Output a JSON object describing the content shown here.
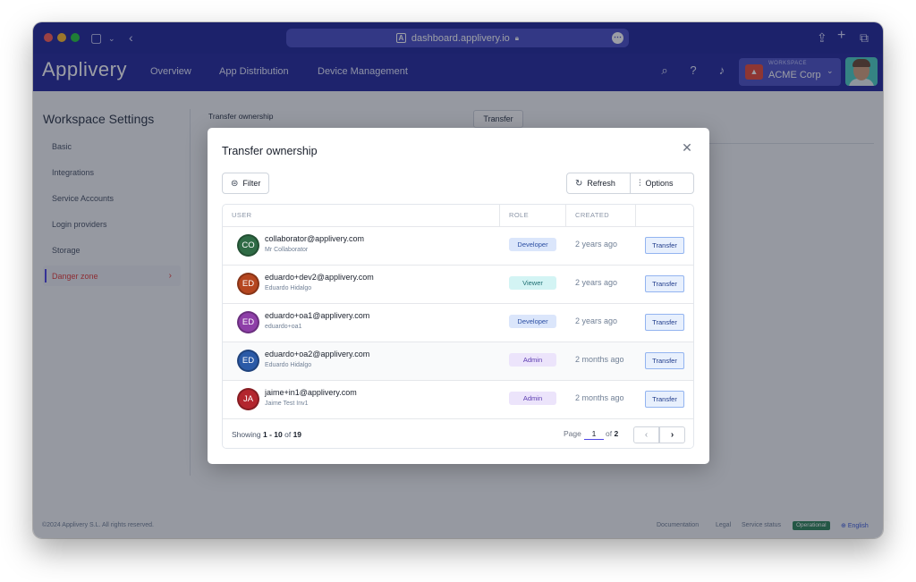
{
  "browser": {
    "url": "dashboard.applivery.io",
    "favicon_letter": "A",
    "more_glyph": "•••"
  },
  "header": {
    "logo": "Applivery",
    "nav": [
      "Overview",
      "App Distribution",
      "Device Management"
    ],
    "workspace_label": "WORKSPACE",
    "workspace_name": "ACME Corp"
  },
  "sidebar": {
    "title": "Workspace Settings",
    "items": [
      {
        "label": "Basic"
      },
      {
        "label": "Integrations"
      },
      {
        "label": "Service Accounts"
      },
      {
        "label": "Login providers"
      },
      {
        "label": "Storage"
      },
      {
        "label": "Danger zone",
        "active": true
      }
    ]
  },
  "background": {
    "section_title": "Transfer ownership",
    "button": "Transfer"
  },
  "footer": {
    "copyright": "©2024 Applivery S.L. All rights reserved.",
    "links": [
      "Documentation",
      "Legal",
      "Service status"
    ],
    "status_badge": "Operational",
    "language": "English"
  },
  "modal": {
    "title": "Transfer ownership",
    "filter_label": "Filter",
    "refresh_label": "Refresh",
    "options_label": "Options",
    "columns": [
      "USER",
      "ROLE",
      "CREATED"
    ],
    "rows": [
      {
        "initials": "CO",
        "email": "collaborator@applivery.com",
        "name": "Mr Collaborator",
        "role": "Developer",
        "created": "2 years ago",
        "action": "Transfer",
        "avatar_color": "#2f6b45"
      },
      {
        "initials": "ED",
        "email": "eduardo+dev2@applivery.com",
        "name": "Eduardo Hidalgo",
        "role": "Viewer",
        "created": "2 years ago",
        "action": "Transfer",
        "avatar_color": "#b5461f"
      },
      {
        "initials": "ED",
        "email": "eduardo+oa1@applivery.com",
        "name": "eduardo+oa1",
        "role": "Developer",
        "created": "2 years ago",
        "action": "Transfer",
        "avatar_color": "#8e3fa8"
      },
      {
        "initials": "ED",
        "email": "eduardo+oa2@applivery.com",
        "name": "Eduardo Hidalgo",
        "role": "Admin",
        "created": "2 months ago",
        "action": "Transfer",
        "avatar_color": "#2b5aa7"
      },
      {
        "initials": "JA",
        "email": "jaime+in1@applivery.com",
        "name": "Jaime Test Inv1",
        "role": "Admin",
        "created": "2 months ago",
        "action": "Transfer",
        "avatar_color": "#b3262e"
      }
    ],
    "pagination": {
      "showing_prefix": "Showing",
      "range": "1 - 10",
      "of_word": "of",
      "total": "19",
      "page_label": "Page",
      "current_page": "1",
      "of_label": "of",
      "total_pages": "2"
    }
  },
  "role_colors": {
    "Developer": {
      "bg": "#dbe6fb",
      "fg": "#2c4fa3"
    },
    "Viewer": {
      "bg": "#d3f4f4",
      "fg": "#1f6f73"
    },
    "Admin": {
      "bg": "#ece4fb",
      "fg": "#5b3bb0"
    }
  }
}
